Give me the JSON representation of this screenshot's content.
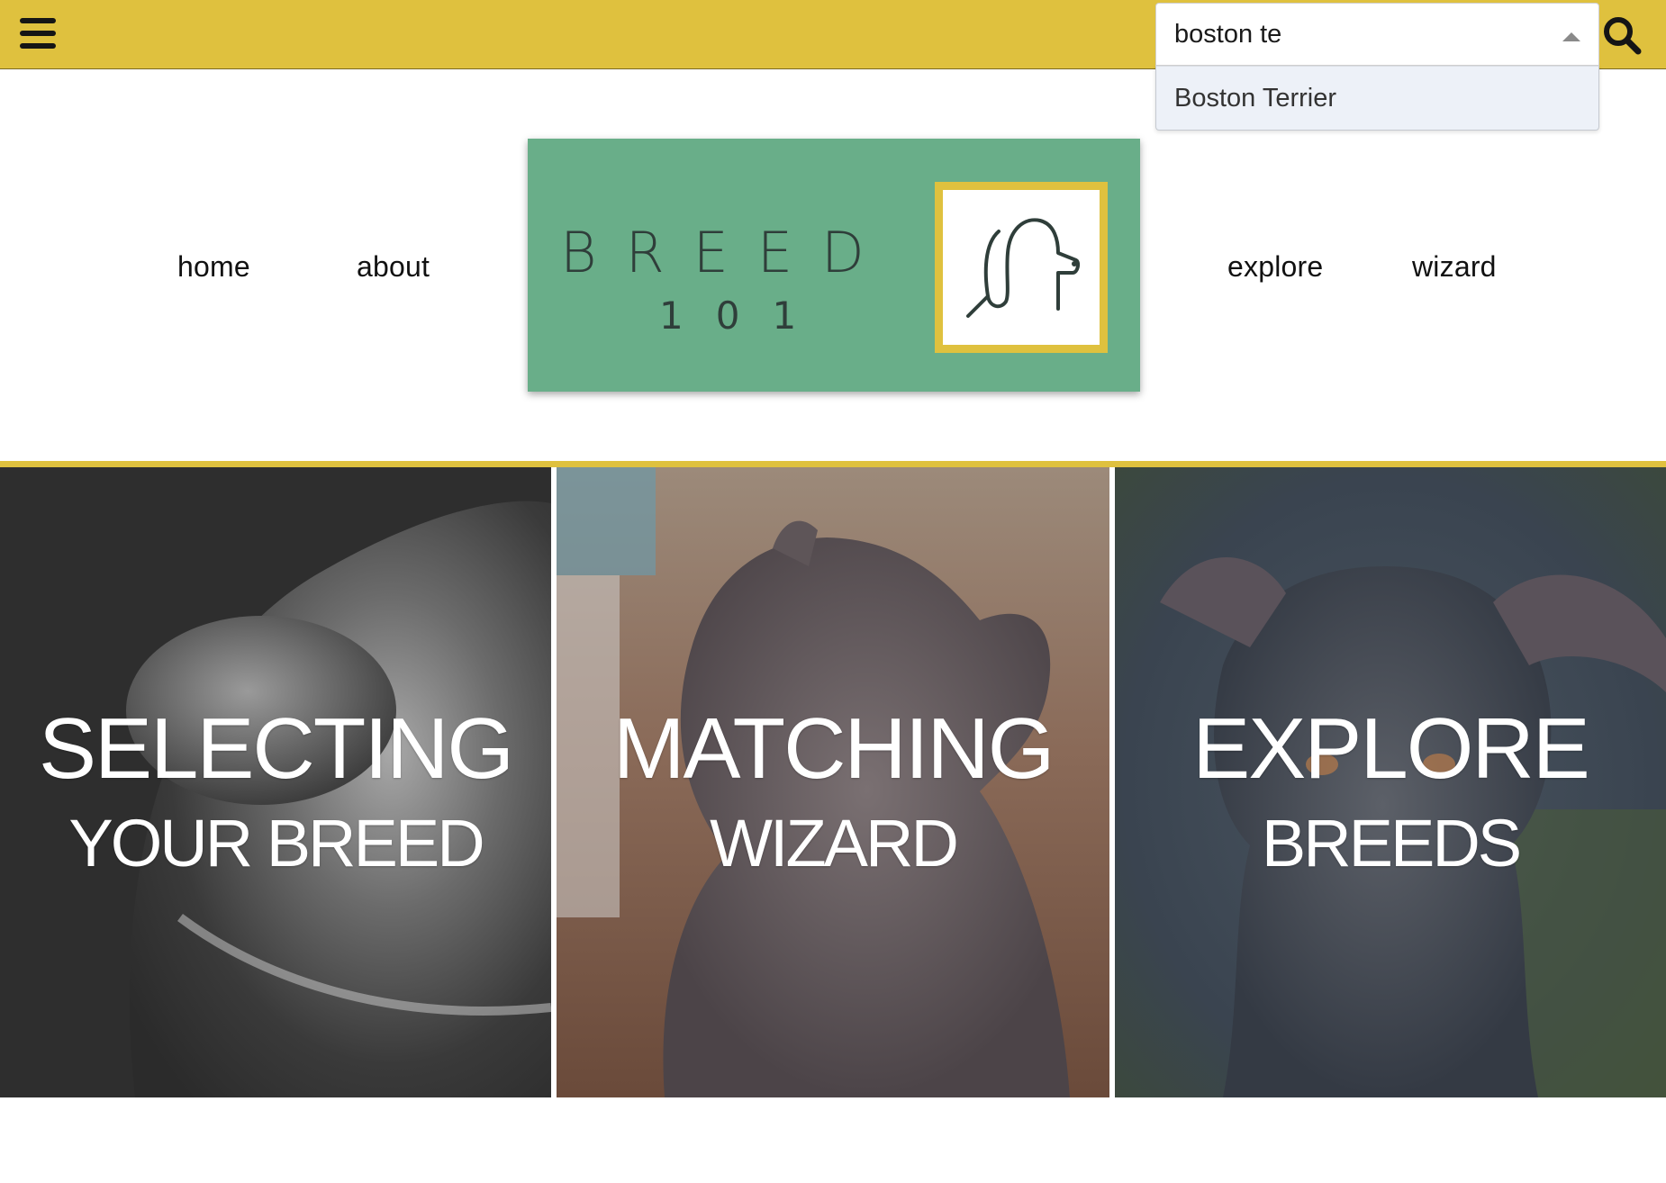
{
  "colors": {
    "accent": "#dfc13e",
    "logo_bg": "#69ae89",
    "dropdown_bg": "#edf1f8"
  },
  "topbar": {
    "menu_icon": "hamburger-icon",
    "search": {
      "value": "boston te",
      "suggestion": "Boston Terrier"
    },
    "search_icon": "magnifier-icon"
  },
  "nav": {
    "home": "home",
    "about": "about",
    "explore": "explore",
    "wizard": "wizard"
  },
  "logo": {
    "word": "BREED",
    "number": "101",
    "icon": "dog-outline-icon"
  },
  "panels": [
    {
      "line1": "SELECTING",
      "line2": "YOUR BREED"
    },
    {
      "line1": "MATCHING",
      "line2": "WIZARD"
    },
    {
      "line1": "EXPLORE",
      "line2": "BREEDS"
    }
  ]
}
